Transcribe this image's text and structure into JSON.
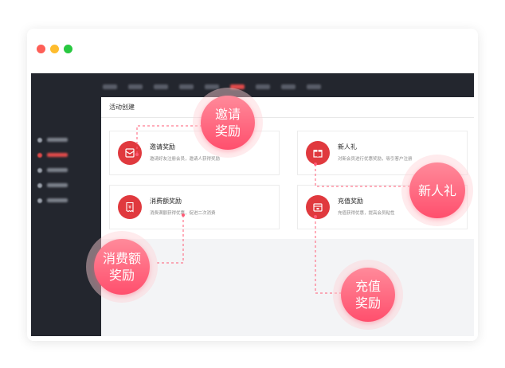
{
  "panel": {
    "title": "活动创建"
  },
  "cards": [
    {
      "title": "邀请奖励",
      "desc": "邀请好友注册会员，邀请人获得奖励"
    },
    {
      "title": "新人礼",
      "desc": "对新会员进行优惠奖励，吸引客户注册"
    },
    {
      "title": "消费额奖励",
      "desc": "消费满额获得优惠，促进二次消费"
    },
    {
      "title": "充值奖励",
      "desc": "充值获得优惠，提高会员粘性"
    }
  ],
  "callouts": {
    "invite": "邀请\n奖励",
    "newbie": "新人礼",
    "spend": "消费额\n奖励",
    "recharge": "充值\n奖励"
  },
  "colors": {
    "accent": "#e0393e",
    "callout": "#ff5b76",
    "dark_bg": "#23262e"
  }
}
